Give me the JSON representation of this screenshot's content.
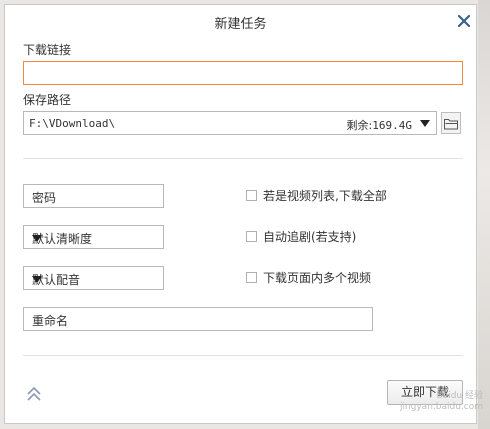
{
  "dialog": {
    "title": "新建任务",
    "close_icon": "close-icon"
  },
  "link": {
    "label": "下载链接",
    "value": ""
  },
  "save": {
    "label": "保存路径",
    "path": "F:\\VDownload\\",
    "remaining_label": "剩余:",
    "remaining_value": "169.4G",
    "folder_icon": "folder-icon"
  },
  "options": {
    "password_placeholder": "密码",
    "quality_selected": "默认清晰度",
    "audio_selected": "默认配音",
    "rename_placeholder": "重命名"
  },
  "checkboxes": {
    "playlist": "若是视频列表,下载全部",
    "auto_follow": "自动追剧(若支持)",
    "multi_video": "下载页面内多个视频"
  },
  "footer": {
    "collapse_icon": "double-chevron-up-icon",
    "download_button": "立即下载"
  },
  "watermark": {
    "line1": "Baidu 经验",
    "line2": "jingyan.baidu.com"
  },
  "colors": {
    "accent_border": "#f28a3b",
    "border": "#b9b9b9",
    "background": "#ffffff"
  }
}
